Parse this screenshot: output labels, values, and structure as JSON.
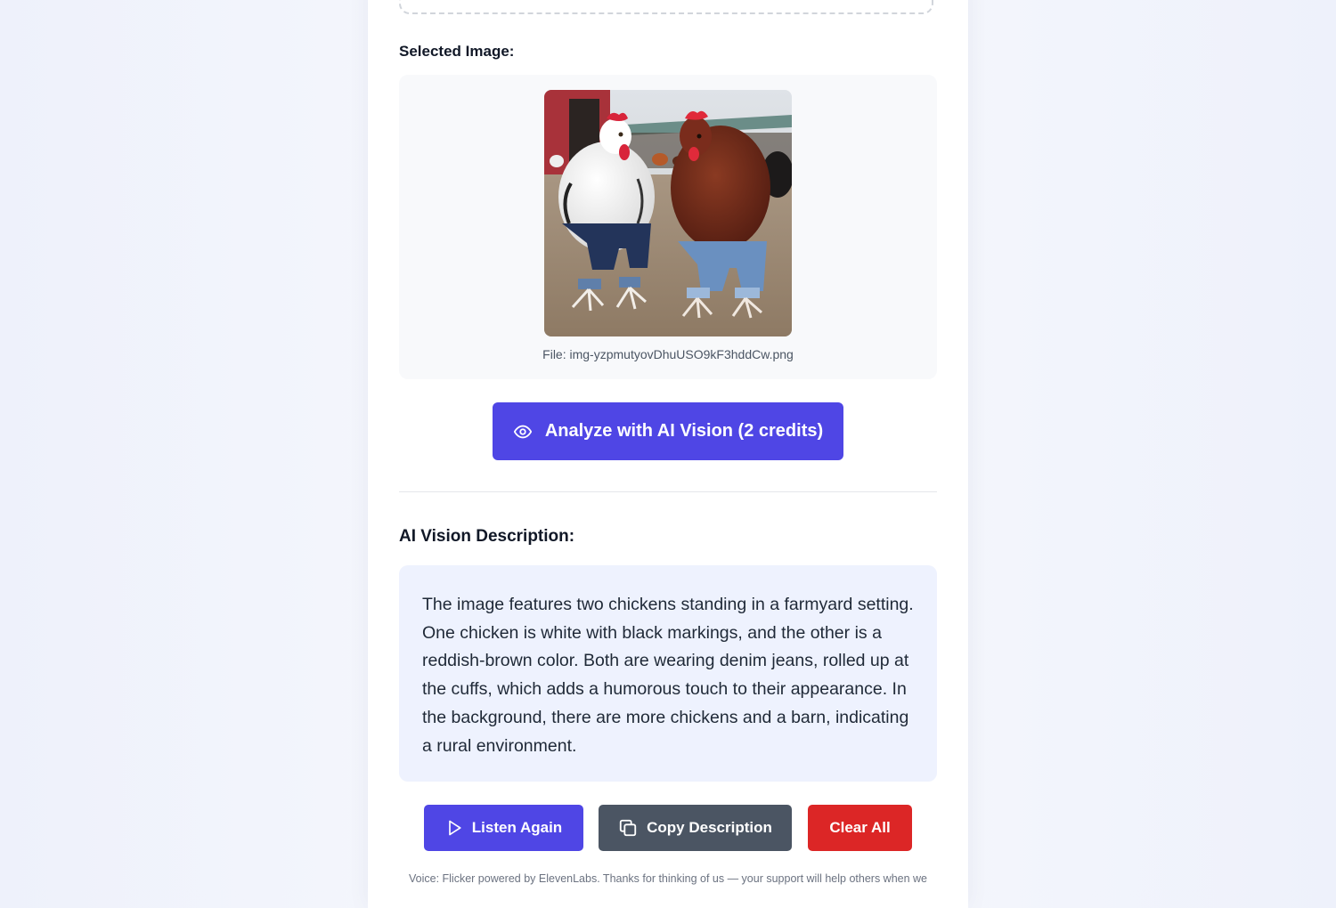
{
  "upload": {
    "selected_label": "Selected Image:",
    "file_caption": "File: img-yzpmutyovDhuUSO9kF3hddCw.png"
  },
  "analyze": {
    "icon": "eye-icon",
    "label": "Analyze with AI Vision (2 credits)"
  },
  "result": {
    "heading": "AI Vision Description:",
    "description": "The image features two chickens standing in a farmyard setting. One chicken is white with black markings, and the other is a reddish-brown color. Both are wearing denim jeans, rolled up at the cuffs, which adds a humorous touch to their appearance. In the background, there are more chickens and a barn, indicating a rural environment."
  },
  "actions": {
    "listen_icon": "play-icon",
    "listen_label": "Listen Again",
    "copy_icon": "copy-icon",
    "copy_label": "Copy Description",
    "clear_label": "Clear All"
  },
  "footer": {
    "note": "Voice: Flicker powered by ElevenLabs. Thanks for thinking of us — your support will help others when we"
  },
  "colors": {
    "primary": "#4f46e5",
    "secondary": "#4b5563",
    "danger": "#dc2626",
    "description_bg": "#eef2fe"
  }
}
